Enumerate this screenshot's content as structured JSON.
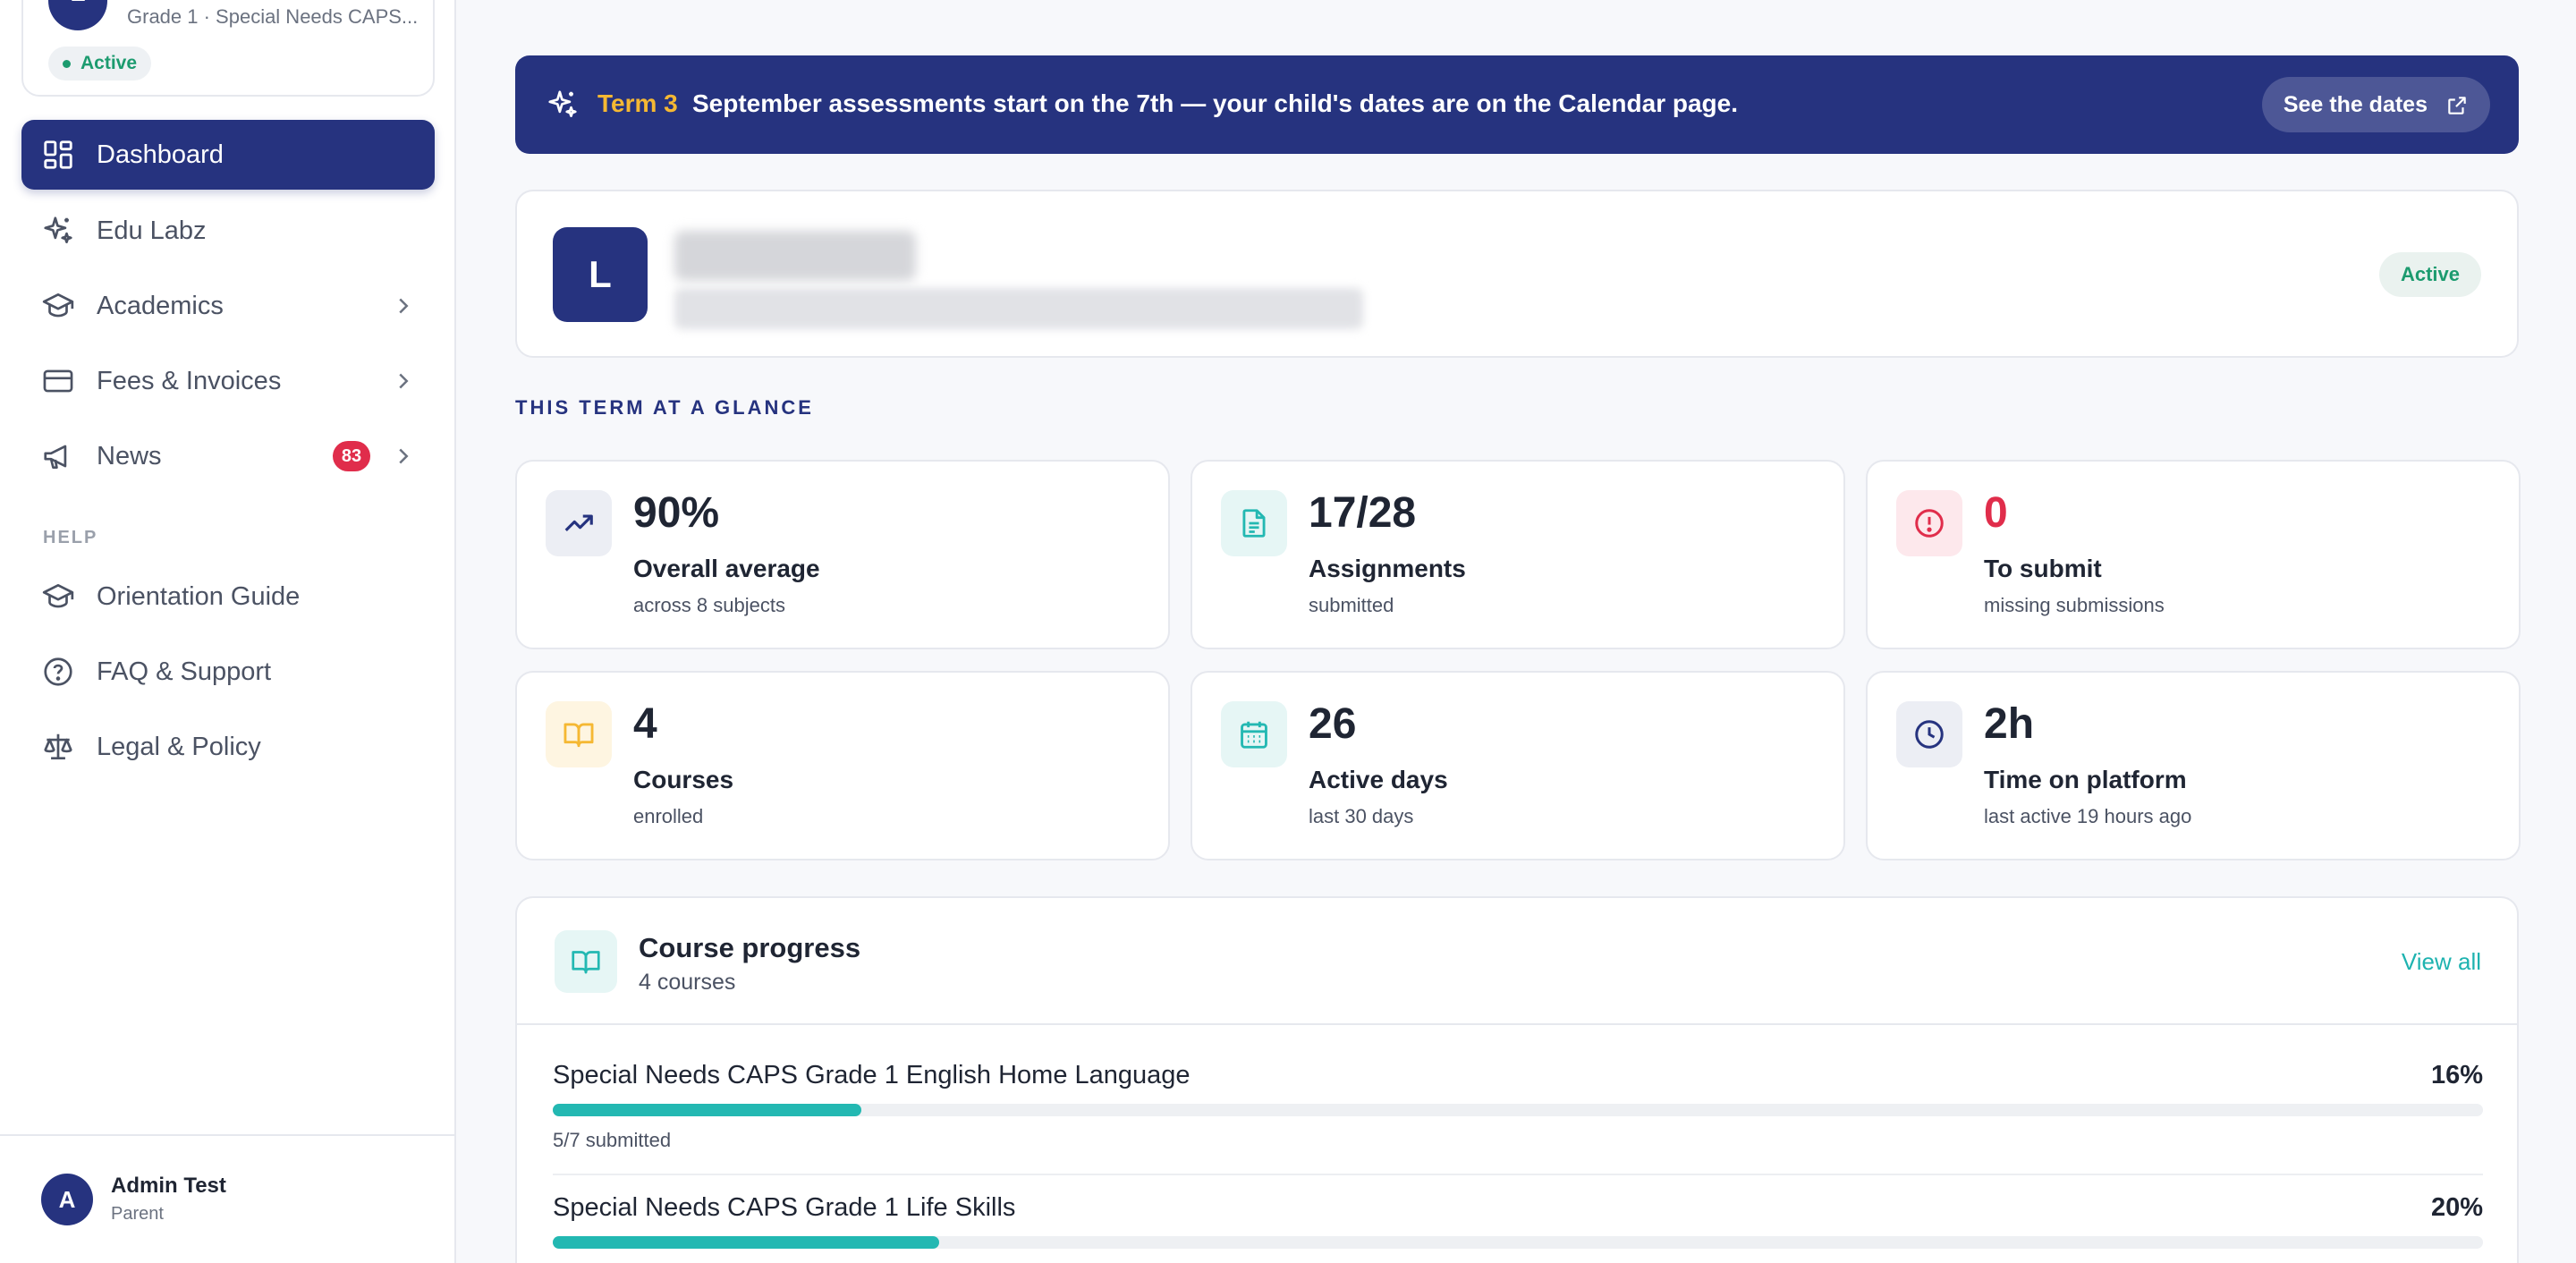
{
  "sidebar": {
    "child": {
      "avatar_letter": "L",
      "subtitle": "Grade 1 · Special Needs CAPS...",
      "status": "Active"
    },
    "nav": [
      {
        "label": "Dashboard",
        "icon": "dashboard-icon"
      },
      {
        "label": "Edu Labz",
        "icon": "sparkles-icon"
      },
      {
        "label": "Academics",
        "icon": "graduation-cap-icon"
      },
      {
        "label": "Fees & Invoices",
        "icon": "credit-card-icon"
      },
      {
        "label": "News",
        "icon": "megaphone-icon",
        "badge": "83"
      }
    ],
    "help_label": "HELP",
    "help_nav": [
      {
        "label": "Orientation Guide",
        "icon": "graduation-cap-icon"
      },
      {
        "label": "FAQ & Support",
        "icon": "help-circle-icon"
      },
      {
        "label": "Legal & Policy",
        "icon": "scale-icon"
      }
    ],
    "user": {
      "avatar_letter": "A",
      "name": "Admin Test",
      "role": "Parent"
    }
  },
  "banner": {
    "term": "Term 3",
    "message": "September assessments start on the 7th — your child's dates are on the Calendar page.",
    "button": "See the dates"
  },
  "profile": {
    "avatar_letter": "L",
    "status": "Active"
  },
  "glance": {
    "title": "THIS TERM AT A GLANCE",
    "stats": [
      {
        "value": "90%",
        "label": "Overall average",
        "sub": "across 8 subjects",
        "icon": "trending-up-icon",
        "accent": "#26337f",
        "bg": "#eceef4"
      },
      {
        "value": "17/28",
        "label": "Assignments",
        "sub": "submitted",
        "icon": "file-text-icon",
        "accent": "#23b8b2",
        "bg": "#e6f6f5"
      },
      {
        "value": "0",
        "label": "To submit",
        "sub": "missing submissions",
        "icon": "alert-circle-icon",
        "accent": "#e02d4b",
        "bg": "#fde8ec"
      },
      {
        "value": "4",
        "label": "Courses",
        "sub": "enrolled",
        "icon": "book-open-icon",
        "accent": "#f5b833",
        "bg": "#fef5e1"
      },
      {
        "value": "26",
        "label": "Active days",
        "sub": "last 30 days",
        "icon": "calendar-icon",
        "accent": "#23b8b2",
        "bg": "#e6f6f5"
      },
      {
        "value": "2h",
        "label": "Time on platform",
        "sub": "last active 19 hours ago",
        "icon": "clock-icon",
        "accent": "#26337f",
        "bg": "#eceef4"
      }
    ]
  },
  "progress": {
    "title": "Course progress",
    "subtitle": "4 courses",
    "view_all": "View all",
    "courses": [
      {
        "name": "Special Needs CAPS Grade 1 English Home Language",
        "percent": "16%",
        "fraction": 0.16,
        "sub": "5/7 submitted"
      },
      {
        "name": "Special Needs CAPS Grade 1 Life Skills",
        "percent": "20%",
        "fraction": 0.2,
        "sub": ""
      }
    ]
  }
}
